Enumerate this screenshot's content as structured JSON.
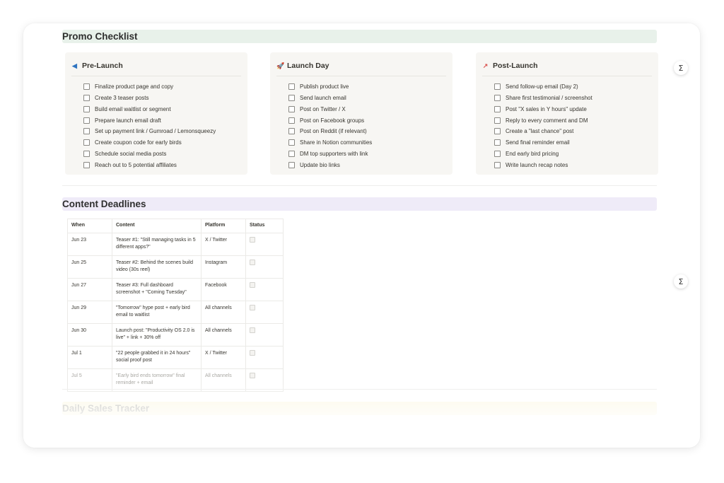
{
  "promo": {
    "title": "Promo Checklist",
    "columns": [
      {
        "icon": "megaphone-icon",
        "icon_glyph": "◀",
        "title": "Pre-Launch",
        "items": [
          "Finalize product page and copy",
          "Create 3 teaser posts",
          "Build email waitlist or segment",
          "Prepare launch email draft",
          "Set up payment link / Gumroad / Lemonsqueezy",
          "Create coupon code for early birds",
          "Schedule social media posts",
          "Reach out to 5 potential affiliates"
        ]
      },
      {
        "icon": "rocket-icon",
        "icon_glyph": "🚀",
        "title": "Launch Day",
        "items": [
          "Publish product live",
          "Send launch email",
          "Post on Twitter / X",
          "Post on Facebook groups",
          "Post on Reddit (if relevant)",
          "Share in Notion communities",
          "DM top supporters with link",
          "Update bio links"
        ]
      },
      {
        "icon": "chart-trend-icon",
        "icon_glyph": "↗",
        "title": "Post-Launch",
        "items": [
          "Send follow-up email (Day 2)",
          "Share first testimonial / screenshot",
          "Post \"X sales in Y hours\" update",
          "Reply to every comment and DM",
          "Create a \"last chance\" post",
          "Send final reminder email",
          "End early bird pricing",
          "Write launch recap notes"
        ]
      }
    ]
  },
  "content": {
    "title": "Content Deadlines",
    "headers": [
      "When",
      "Content",
      "Platform",
      "Status"
    ],
    "rows": [
      {
        "when": "Jun 23",
        "content": "Teaser #1: \"Still managing tasks in 5 different apps?\"",
        "platform": "X / Twitter"
      },
      {
        "when": "Jun 25",
        "content": "Teaser #2: Behind the scenes build video (30s reel)",
        "platform": "Instagram"
      },
      {
        "when": "Jun 27",
        "content": "Teaser #3: Full dashboard screenshot + \"Coming Tuesday\"",
        "platform": "Facebook"
      },
      {
        "when": "Jun 29",
        "content": "\"Tomorrow\" hype post + early bird email to waitlist",
        "platform": "All channels"
      },
      {
        "when": "Jun 30",
        "content": "Launch post: \"Productivity OS 2.0 is live\" + link + 30% off",
        "platform": "All channels"
      },
      {
        "when": "Jul 1",
        "content": "\"22 people grabbed it in 24 hours\" social proof post",
        "platform": "X / Twitter"
      },
      {
        "when": "Jul 5",
        "content": "\"Early bird ends tomorrow\" final reminder + email",
        "platform": "All channels"
      }
    ]
  },
  "daily": {
    "title": "Daily Sales Tracker"
  },
  "side_buttons": {
    "icon": "sigma-icon",
    "glyph": "Σ"
  }
}
